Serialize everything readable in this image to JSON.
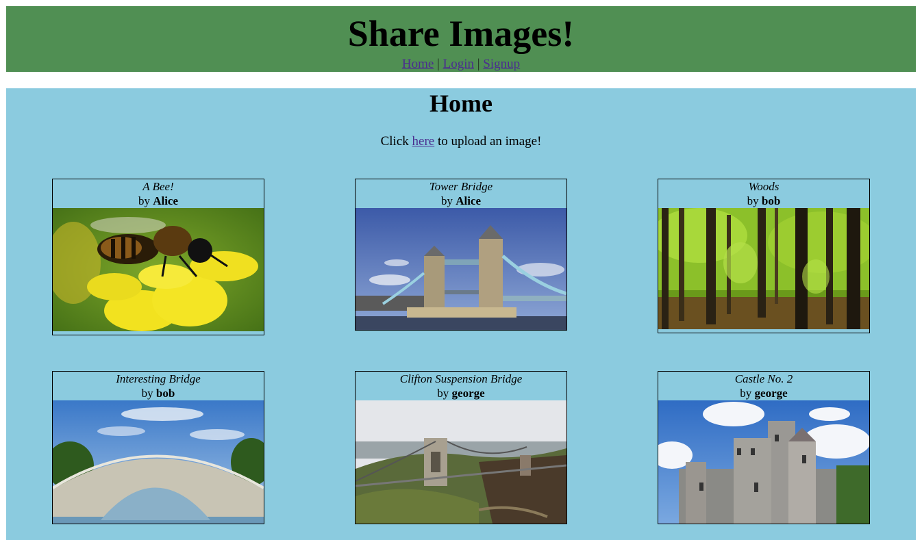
{
  "header": {
    "title": "Share Images!",
    "nav": {
      "home": "Home",
      "sep1": "|",
      "login": "Login",
      "sep2": "|",
      "signup": "Signup"
    }
  },
  "main": {
    "heading": "Home",
    "upload": {
      "prefix": "Click",
      "link": "here",
      "suffix": "to upload an image!"
    },
    "images": [
      {
        "title": "A Bee!",
        "by": "by",
        "author": "Alice"
      },
      {
        "title": "Tower Bridge",
        "by": "by",
        "author": "Alice"
      },
      {
        "title": "Woods",
        "by": "by",
        "author": "bob"
      },
      {
        "title": "Interesting Bridge",
        "by": "by",
        "author": "bob"
      },
      {
        "title": "Clifton Suspension Bridge",
        "by": "by",
        "author": "george"
      },
      {
        "title": "Castle No. 2",
        "by": "by",
        "author": "george"
      }
    ]
  },
  "colors": {
    "header_bg": "#508f53",
    "main_bg": "#8bcbdf",
    "link": "#4b2e8f"
  }
}
